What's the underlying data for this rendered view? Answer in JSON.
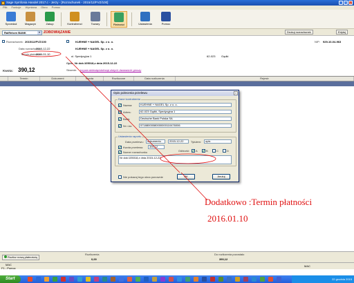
{
  "window": {
    "title": "Sage Symfonia Handel 2017.c - Jerzy - [Rozrachunek - 2015/12/FVZ/100]",
    "min": "_",
    "max": "□",
    "close": "×"
  },
  "menu": [
    "Plik",
    "Funkcje",
    "Wymiana",
    "Okno",
    "Pomoc"
  ],
  "toolbar": {
    "items": [
      {
        "label": "Sprzedaż",
        "color": "#3a7bd5"
      },
      {
        "label": "Magazyn",
        "color": "#c89040"
      },
      {
        "label": "Zakup",
        "color": "#2a9a4a"
      },
      {
        "label": "Kontrahenci",
        "color": "#d09020"
      },
      {
        "label": "Towary",
        "color": "#6a7a9a"
      },
      {
        "label": "Płatności",
        "color": "#3aa060"
      },
      {
        "label": "Ustawienia",
        "color": "#3070c0"
      },
      {
        "label": "Pomoc",
        "color": "#2a50a0"
      }
    ]
  },
  "bankbar": {
    "bank": "Raiffeisen BANK",
    "arrow": "▼",
    "mode": "ZOBOWIĄZANIE",
    "print": "Drukuj rozrachunek",
    "edit": "Edytuj"
  },
  "doc": {
    "rozrachunek_label": "Rozrachunek:",
    "rozrachunek": "2015/12/FVZ/100",
    "data_rozr_label": "Data rozrachunku:",
    "data_rozr": "2015-12-22",
    "termin_label": "Termin płatności:",
    "termin": "2016-01-10",
    "kontrahent1": "KUEHNE + NAGEL Sp. z o. o.",
    "kontrahent2": "KUEHNE + NAGEL Sp. z o. o.",
    "adres": "ul. Spedycyjna 1",
    "kod": "62-023",
    "miasto": "Gądki",
    "nip_label": "NIP:",
    "nip": "929-10-04-963",
    "opis_label": "Opis:",
    "opis": "Nr dok:105018,z dnia 2015-12-22",
    "kwota_label": "Kwota:",
    "kwota": "390,12",
    "slownie_label": "Słownie:",
    "slownie": "trzysta dziewięćdziesiąt złotych dwanaście groszy"
  },
  "grid": {
    "headers": [
      "Termin",
      "Dokument",
      "Kwota",
      "Rozliczone",
      "Data rozliczenia",
      "Rejestr"
    ]
  },
  "footer": {
    "add_btn": "Rozlicz nową płatnością",
    "rozliczenia_label": "Rozliczenia",
    "rozliczenia": "0,00",
    "pozostalo_label": "Do rozliczenia pozostało",
    "pozostalo": "390,12"
  },
  "status": {
    "left": "MAC",
    "f1": "F1 - Pomoc",
    "right": "MAC"
  },
  "taskbar": {
    "start": "Start",
    "time": "22 grudnia 2015"
  },
  "dialog": {
    "title": "Opis polecenia przelewu",
    "close": "×",
    "dane_label": "Dane kontrahenta",
    "nazwa_label": "Nazwa:",
    "nazwa": "KUEHNE + NAGEL Sp. z o. o.",
    "adres_label": "Adres:",
    "adres": "62-023 Gądki, Spedycyjna 1",
    "bank_label": "Bank:",
    "bank": "Deutsche Bank Polska SA",
    "rachunek_label": "Nr r-ku:",
    "rachunek": "57188000080000000110476006",
    "ust_label": "Ustawienia raportu",
    "data_przel_label": "Data przelewu:",
    "data_przel_mode": "dokumentu",
    "data_przel": "2015-12-22",
    "tytul_label": "Tytułem:",
    "tytul": "opis",
    "kwota_label": "Kwota przelewu:",
    "kwota": "390,12",
    "numer_label": "Numer rozrachunku",
    "odbiorki_label": "Odbiorki:",
    "odb": [
      "A",
      "B",
      "C",
      "D"
    ],
    "opis_text": "Nr dok:105018,z dnia 2015-12-22",
    "nie_pokazuj": "Nie pokazuj tego okna ponownie",
    "ok": "OK",
    "anuluj": "Anuluj",
    "check": "✔"
  },
  "annotation": {
    "line1": "Dodatkowo :Termin płatności",
    "line2": "2016.01.10",
    "color": "#e01010"
  }
}
